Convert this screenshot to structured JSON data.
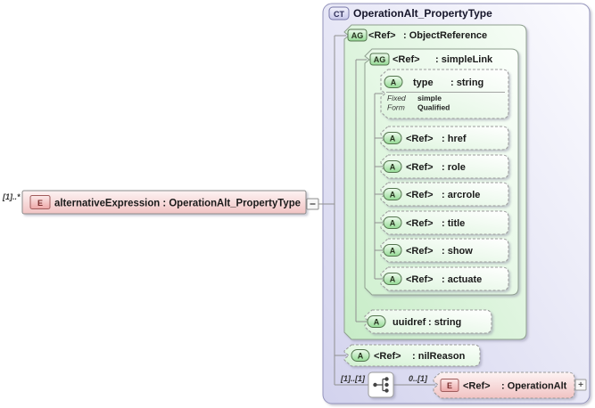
{
  "element": {
    "multiplicity": "[1]..*",
    "badge": "E",
    "label": "alternativeExpression : OperationAlt_PropertyType"
  },
  "complex_type": {
    "badge": "CT",
    "title": "OperationAlt_PropertyType"
  },
  "object_reference": {
    "badge": "AG",
    "ref": "<Ref>",
    "label": ": ObjectReference"
  },
  "simple_link": {
    "badge": "AG",
    "ref": "<Ref>",
    "label": ": simpleLink",
    "type_attr": {
      "badge": "A",
      "name": "type",
      "label": ": string",
      "facets": [
        {
          "k": "Fixed",
          "v": "simple"
        },
        {
          "k": "Form",
          "v": "Qualified"
        }
      ]
    },
    "attrs": [
      {
        "badge": "A",
        "ref": "<Ref>",
        "label": ": href"
      },
      {
        "badge": "A",
        "ref": "<Ref>",
        "label": ": role"
      },
      {
        "badge": "A",
        "ref": "<Ref>",
        "label": ": arcrole"
      },
      {
        "badge": "A",
        "ref": "<Ref>",
        "label": ": title"
      },
      {
        "badge": "A",
        "ref": "<Ref>",
        "label": ": show"
      },
      {
        "badge": "A",
        "ref": "<Ref>",
        "label": ": actuate"
      }
    ]
  },
  "uuidref_attr": {
    "badge": "A",
    "name": "uuidref",
    "label": ": string"
  },
  "nil_reason_attr": {
    "badge": "A",
    "ref": "<Ref>",
    "label": ": nilReason"
  },
  "sequence": {
    "left_multiplicity": "[1]..[1]",
    "right_multiplicity": "0..[1]"
  },
  "operation_alt": {
    "badge": "E",
    "ref": "<Ref>",
    "label": ": OperationAlt",
    "expand_glyph": "+"
  },
  "colors": {
    "complex_type_fill": "#d4d4ee",
    "complex_type_border": "#9494bc",
    "attr_group_fill": "#c9ecc9",
    "attr_box_fill": "#ddf4dd",
    "green_badge": "#98dd98",
    "element_fill": "#f2c4c4",
    "element_badge": "#efa9a9",
    "connector_line": "#909090"
  }
}
